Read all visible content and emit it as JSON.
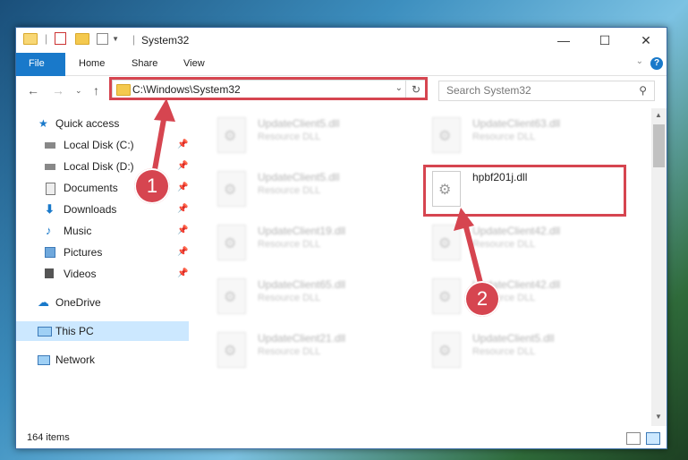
{
  "window": {
    "title": "System32",
    "controls": {
      "minimize": "—",
      "maximize": "☐",
      "close": "✕"
    }
  },
  "ribbon": {
    "tabs": [
      "File",
      "Home",
      "Share",
      "View"
    ],
    "help": "?"
  },
  "navigation": {
    "address": "C:\\Windows\\System32",
    "search_placeholder": "Search System32"
  },
  "sidebar": {
    "items": [
      {
        "label": "Quick access",
        "icon": "star-icon"
      },
      {
        "label": "Local Disk (C:)",
        "icon": "drive-icon"
      },
      {
        "label": "Local Disk (D:)",
        "icon": "drive-icon"
      },
      {
        "label": "Documents",
        "icon": "documents-icon"
      },
      {
        "label": "Downloads",
        "icon": "download-icon"
      },
      {
        "label": "Music",
        "icon": "music-icon"
      },
      {
        "label": "Pictures",
        "icon": "pictures-icon"
      },
      {
        "label": "Videos",
        "icon": "videos-icon"
      },
      {
        "label": "OneDrive",
        "icon": "cloud-icon"
      },
      {
        "label": "This PC",
        "icon": "computer-icon"
      },
      {
        "label": "Network",
        "icon": "network-icon"
      }
    ]
  },
  "files": [
    {
      "name": "UpdateClient5.dll",
      "type": "Resource DLL"
    },
    {
      "name": "UpdateClient63.dll",
      "type": "Resource DLL"
    },
    {
      "name": "UpdateClient5.dll",
      "type": "Resource DLL"
    },
    {
      "name": "hpbf201j.dll",
      "type": ""
    },
    {
      "name": "UpdateClient19.dll",
      "type": "Resource DLL"
    },
    {
      "name": "UpdateClient42.dll",
      "type": "Resource DLL"
    },
    {
      "name": "UpdateClient65.dll",
      "type": "Resource DLL"
    },
    {
      "name": "UpdateClient42.dll",
      "type": "Resource DLL"
    },
    {
      "name": "UpdateClient21.dll",
      "type": "Resource DLL"
    },
    {
      "name": "UpdateClient5.dll",
      "type": "Resource DLL"
    }
  ],
  "status": {
    "items_count": "164 items"
  },
  "annotations": {
    "step1": "1",
    "step2": "2"
  },
  "colors": {
    "accent": "#1979ca",
    "highlight": "#d64550"
  }
}
